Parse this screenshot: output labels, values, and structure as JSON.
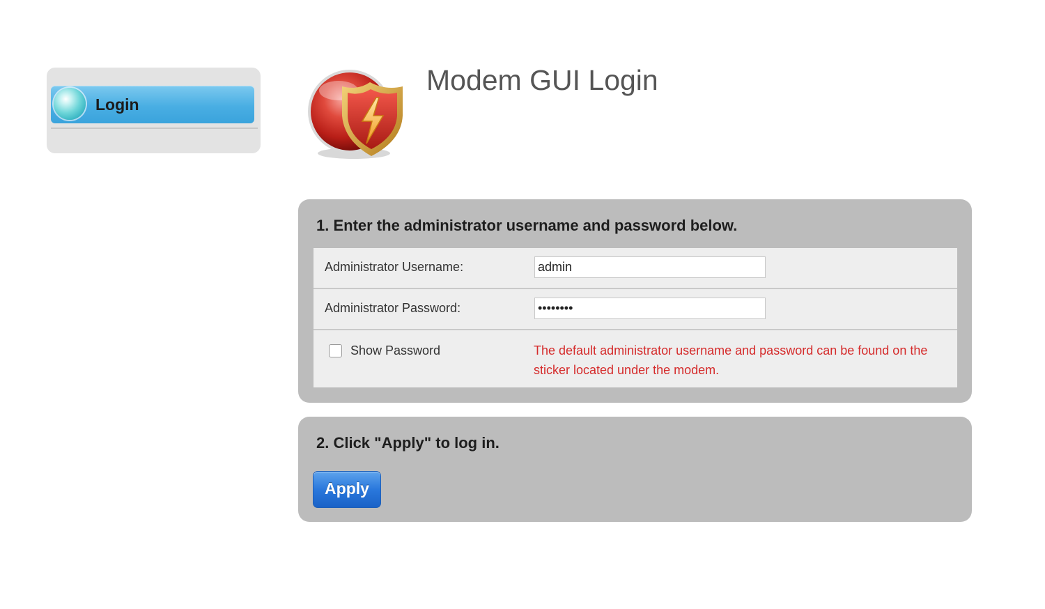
{
  "sidebar": {
    "items": [
      {
        "label": "Login",
        "active": true
      }
    ]
  },
  "header": {
    "title": "Modem GUI Login",
    "logo_icon": "shield-lightning-icon"
  },
  "step1": {
    "title": "1. Enter the administrator username and password below.",
    "username": {
      "label": "Administrator Username:",
      "value": "admin"
    },
    "password": {
      "label": "Administrator Password:",
      "value": "password"
    },
    "show_password": {
      "label": "Show Password",
      "checked": false
    },
    "hint": "The default administrator username and password can be found on the sticker located under the modem."
  },
  "step2": {
    "title": "2. Click \"Apply\" to log in.",
    "apply_label": "Apply"
  },
  "colors": {
    "panel_bg": "#bcbcbc",
    "form_bg": "#eeeeee",
    "hint_text": "#d52b2b",
    "sidebar_active": "#49aee3",
    "apply_button": "#2a78dc"
  }
}
